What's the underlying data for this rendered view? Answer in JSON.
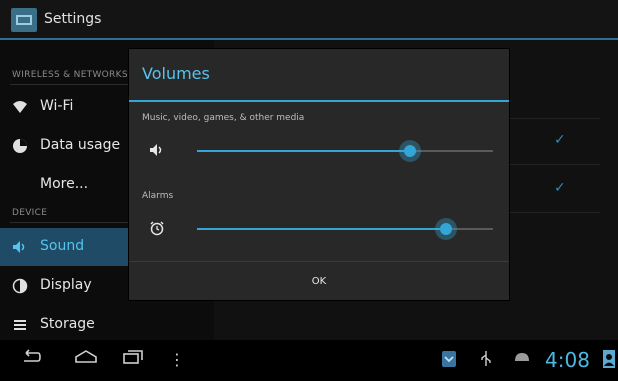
{
  "actionbar": {
    "title": "Settings",
    "icon": "settings-icon"
  },
  "sidebar": {
    "sections": [
      {
        "header": "WIRELESS & NETWORKS"
      },
      {
        "header": "DEVICE"
      }
    ],
    "items": [
      {
        "label": "Wi-Fi",
        "icon": "wifi-icon"
      },
      {
        "label": "Data usage",
        "icon": "data-usage-icon"
      },
      {
        "label": "More..."
      },
      {
        "label": "Sound",
        "icon": "sound-icon",
        "active": true
      },
      {
        "label": "Display",
        "icon": "display-icon"
      },
      {
        "label": "Storage",
        "icon": "storage-icon"
      }
    ]
  },
  "dialog": {
    "title": "Volumes",
    "media_label": "Music, video, games, & other media",
    "media_level": 0.72,
    "alarms_label": "Alarms",
    "alarms_level": 0.84,
    "ok_label": "OK"
  },
  "statusbar": {
    "time": "4:08"
  },
  "colors": {
    "accent": "#33a6d6",
    "dialog_bg": "#282828",
    "active_item": "#1f4b66"
  }
}
